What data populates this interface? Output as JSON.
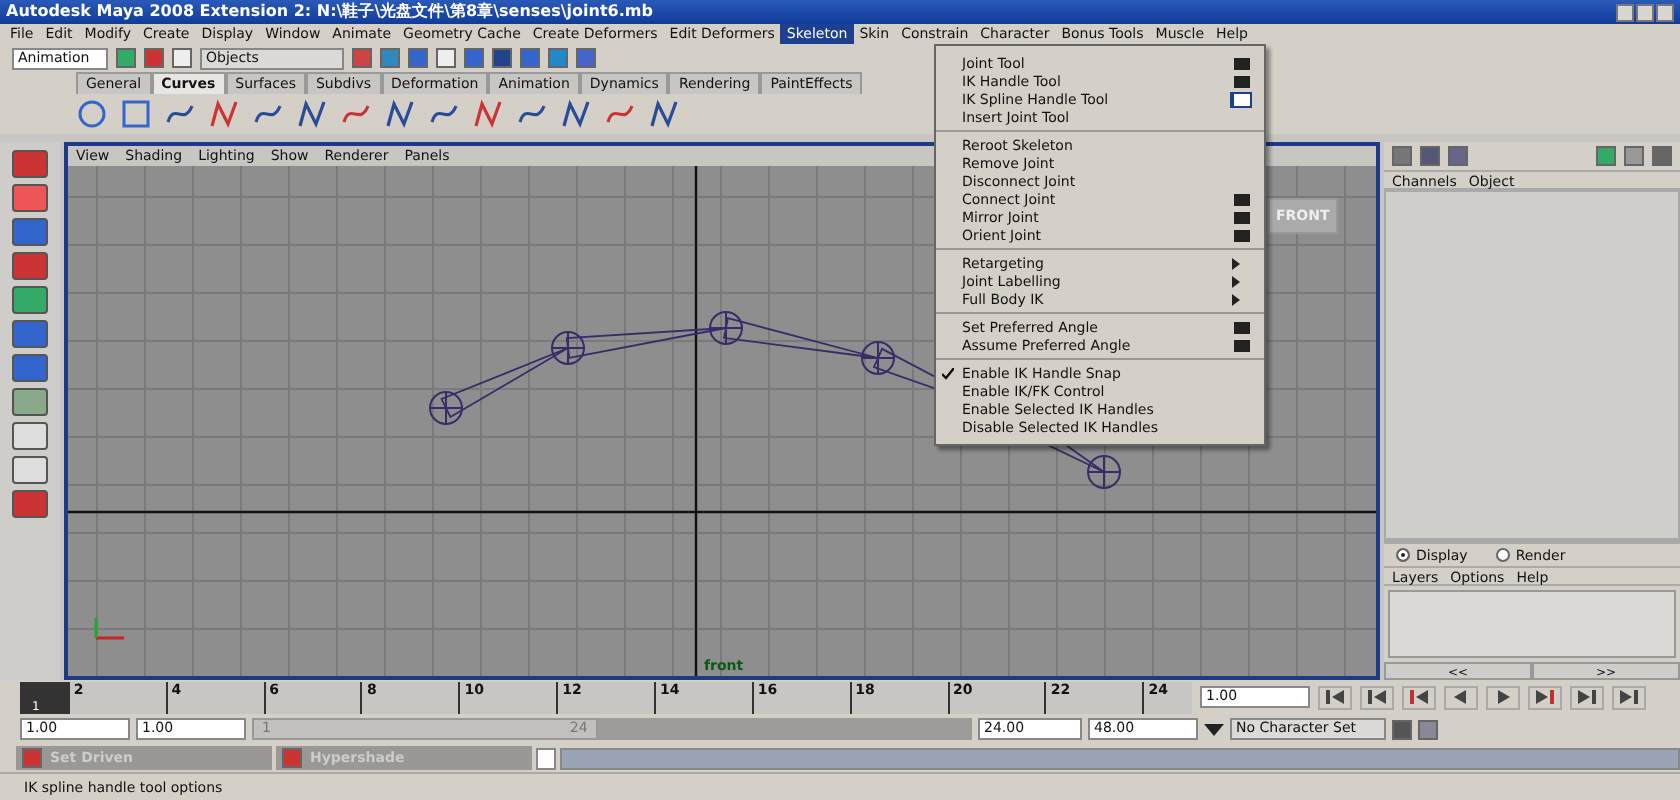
{
  "window": {
    "title": "Autodesk Maya 2008 Extension 2: N:\\鞋子\\光盘文件\\第8章\\senses\\joint6.mb"
  },
  "menubar": [
    {
      "label": "File",
      "selected": false
    },
    {
      "label": "Edit",
      "selected": false
    },
    {
      "label": "Modify",
      "selected": false
    },
    {
      "label": "Create",
      "selected": false
    },
    {
      "label": "Display",
      "selected": false
    },
    {
      "label": "Window",
      "selected": false
    },
    {
      "label": "Animate",
      "selected": false
    },
    {
      "label": "Geometry Cache",
      "selected": false
    },
    {
      "label": "Create Deformers",
      "selected": false
    },
    {
      "label": "Edit Deformers",
      "selected": false
    },
    {
      "label": "Skeleton",
      "selected": true
    },
    {
      "label": "Skin",
      "selected": false
    },
    {
      "label": "Constrain",
      "selected": false
    },
    {
      "label": "Character",
      "selected": false
    },
    {
      "label": "Bonus Tools",
      "selected": false
    },
    {
      "label": "Muscle",
      "selected": false
    },
    {
      "label": "Help",
      "selected": false
    }
  ],
  "status_line": {
    "mode": "Animation",
    "selection_mask": "Objects"
  },
  "shelf_tabs": [
    {
      "label": "General",
      "selected": false
    },
    {
      "label": "Curves",
      "selected": true
    },
    {
      "label": "Surfaces",
      "selected": false
    },
    {
      "label": "Subdivs",
      "selected": false
    },
    {
      "label": "Deformation",
      "selected": false
    },
    {
      "label": "Animation",
      "selected": false
    },
    {
      "label": "Dynamics",
      "selected": false
    },
    {
      "label": "Rendering",
      "selected": false
    },
    {
      "label": "PaintEffects",
      "selected": false
    }
  ],
  "skeleton_menu": {
    "sections": [
      [
        {
          "label": "Joint Tool",
          "kind": "option",
          "checked": false,
          "highlighted": false
        },
        {
          "label": "IK Handle Tool",
          "kind": "option",
          "checked": false,
          "highlighted": false
        },
        {
          "label": "IK Spline Handle Tool",
          "kind": "option",
          "checked": false,
          "highlighted": true
        },
        {
          "label": "Insert Joint Tool",
          "kind": "plain",
          "checked": false,
          "highlighted": false
        }
      ],
      [
        {
          "label": "Reroot Skeleton",
          "kind": "plain",
          "checked": false,
          "highlighted": false
        },
        {
          "label": "Remove Joint",
          "kind": "plain",
          "checked": false,
          "highlighted": false
        },
        {
          "label": "Disconnect Joint",
          "kind": "plain",
          "checked": false,
          "highlighted": false
        },
        {
          "label": "Connect Joint",
          "kind": "option",
          "checked": false,
          "highlighted": false
        },
        {
          "label": "Mirror Joint",
          "kind": "option",
          "checked": false,
          "highlighted": false
        },
        {
          "label": "Orient Joint",
          "kind": "option",
          "checked": false,
          "highlighted": false
        }
      ],
      [
        {
          "label": "Retargeting",
          "kind": "submenu",
          "checked": false,
          "highlighted": false
        },
        {
          "label": "Joint Labelling",
          "kind": "submenu",
          "checked": false,
          "highlighted": false
        },
        {
          "label": "Full Body IK",
          "kind": "submenu",
          "checked": false,
          "highlighted": false
        }
      ],
      [
        {
          "label": "Set Preferred Angle",
          "kind": "option",
          "checked": false,
          "highlighted": false
        },
        {
          "label": "Assume Preferred Angle",
          "kind": "option",
          "checked": false,
          "highlighted": false
        }
      ],
      [
        {
          "label": "Enable IK Handle Snap",
          "kind": "plain",
          "checked": true,
          "highlighted": false
        },
        {
          "label": "Enable IK/FK Control",
          "kind": "plain",
          "checked": false,
          "highlighted": false
        },
        {
          "label": "Enable Selected IK Handles",
          "kind": "plain",
          "checked": false,
          "highlighted": false
        },
        {
          "label": "Disable Selected IK Handles",
          "kind": "plain",
          "checked": false,
          "highlighted": false
        }
      ]
    ]
  },
  "viewport": {
    "menu": [
      "View",
      "Shading",
      "Lighting",
      "Show",
      "Renderer",
      "Panels"
    ],
    "camera_label": "FRONT",
    "camera_name": "front"
  },
  "channel_box": {
    "menu": [
      "Channels",
      "Object"
    ],
    "layer_modes": [
      {
        "label": "Display",
        "selected": true
      },
      {
        "label": "Render",
        "selected": false
      }
    ],
    "layer_menu": [
      "Layers",
      "Options",
      "Help"
    ],
    "scroll_left": "<<",
    "scroll_right": ">>"
  },
  "time_slider": {
    "ticks": [
      "2",
      "4",
      "6",
      "8",
      "10",
      "12",
      "14",
      "16",
      "18",
      "20",
      "22",
      "24"
    ],
    "current_frame": "1",
    "current_time": "1.00",
    "level": 0
  },
  "range_slider": {
    "start_time": "1.00",
    "start_range": "1.00",
    "range_start": "1",
    "range_end": "24",
    "level": 0.48,
    "end_range": "24.00",
    "end_time": "48.00",
    "character_set": "No Character Set"
  },
  "minimized_windows": [
    {
      "title": "Set Driven"
    },
    {
      "title": "Hypershade"
    }
  ],
  "help_line": "IK spline handle tool options"
}
